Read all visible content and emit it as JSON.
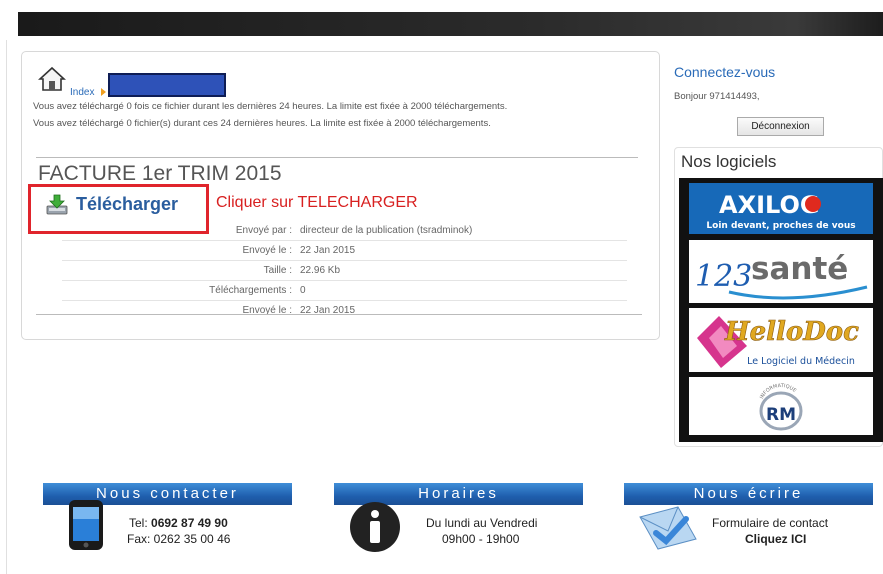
{
  "breadcrumb": {
    "index_label": "Index"
  },
  "info": {
    "line1": "Vous avez téléchargé 0 fois ce fichier durant les dernières 24 heures. La limite est fixée à 2000 téléchargements.",
    "line2": "Vous avez téléchargé 0 fichier(s) durant ces 24 dernières heures. La limite est fixée à 2000 téléchargements."
  },
  "file": {
    "title": "FACTURE 1er TRIM 2015",
    "download_label": "Télécharger",
    "annotation": "Cliquer sur TELECHARGER",
    "meta": [
      {
        "key": "Envoyé par :",
        "value": "directeur de la publication (tsradminok)"
      },
      {
        "key": "Envoyé le :",
        "value": "22 Jan 2015"
      },
      {
        "key": "Taille :",
        "value": "22.96 Kb"
      },
      {
        "key": "Téléchargements :",
        "value": "0"
      },
      {
        "key": "Envoyé le :",
        "value": "22 Jan 2015"
      }
    ]
  },
  "sidebar": {
    "login_title": "Connectez-vous",
    "greeting": "Bonjour 971414493,",
    "logout_label": "Déconnexion",
    "software_title": "Nos logiciels",
    "logos": {
      "axilog": {
        "name": "AXILOG",
        "tagline": "Loin devant, proches de vous"
      },
      "sante": {
        "name": "santé",
        "digits": "123"
      },
      "hellodoc": {
        "name": "HelloDoc",
        "tagline": "Le Logiciel du Médecin"
      },
      "rm": {
        "name": "RM",
        "arc_text": "INFORMATIQUE"
      }
    }
  },
  "footer": {
    "contact": {
      "title": "Nous contacter",
      "tel_prefix": "Tel: ",
      "tel": "0692 87 49 90",
      "fax": "Fax: 0262 35 00 46"
    },
    "hours": {
      "title": "Horaires",
      "days": "Du lundi au Vendredi",
      "times": "09h00 - 19h00"
    },
    "write": {
      "title": "Nous écrire",
      "form": "Formulaire de contact",
      "cta": "Cliquez ICI"
    }
  },
  "colors": {
    "link": "#2a6bb8",
    "highlight": "#e0242c",
    "banner": "#1f5fae"
  }
}
